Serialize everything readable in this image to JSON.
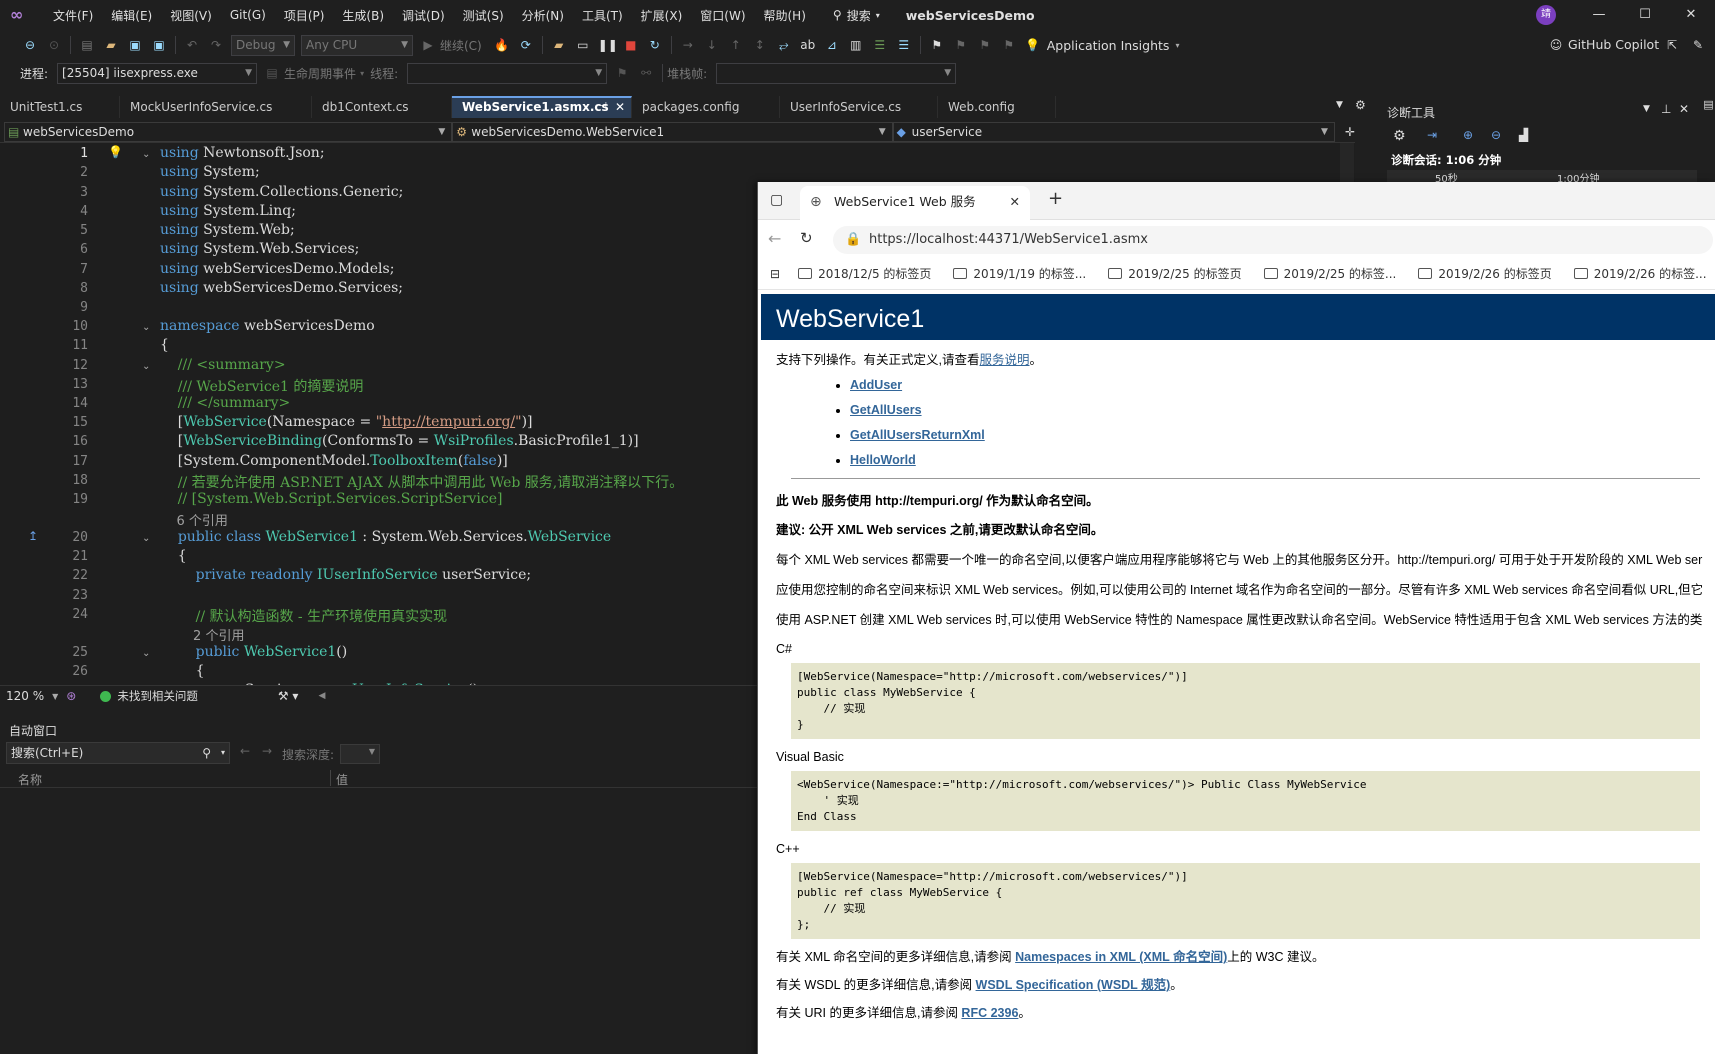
{
  "menubar": {
    "items": [
      "文件(F)",
      "编辑(E)",
      "视图(V)",
      "Git(G)",
      "项目(P)",
      "生成(B)",
      "调试(D)",
      "测试(S)",
      "分析(N)",
      "工具(T)",
      "扩展(X)",
      "窗口(W)",
      "帮助(H)"
    ],
    "search": "搜索",
    "title": "webServicesDemo",
    "avatar": "靖"
  },
  "toolbar": {
    "config": "Debug",
    "platform": "Any CPU",
    "continue": "继续(C)",
    "insights": "Application Insights",
    "copilot": "GitHub Copilot"
  },
  "toolbar2": {
    "process_label": "进程:",
    "process_value": "[25504] iisexpress.exe",
    "lifecycle": "生命周期事件",
    "thread_label": "线程:",
    "stack_label": "堆栈帧:"
  },
  "tabs": [
    "UnitTest1.cs",
    "MockUserInfoService.cs",
    "db1Context.cs",
    "WebService1.asmx.cs",
    "packages.config",
    "UserInfoService.cs",
    "Web.config"
  ],
  "nav": {
    "project": "webServicesDemo",
    "class": "webServicesDemo.WebService1",
    "member": "userService"
  },
  "diag": {
    "title": "诊断工具",
    "session": "诊断会话: 1:06 分钟",
    "t1": "50秒",
    "t2": "1:00分钟"
  },
  "status": {
    "zoom": "120 %",
    "issues": "未找到相关问题"
  },
  "autos": {
    "title": "自动窗口",
    "search": "搜索(Ctrl+E)",
    "depth": "搜索深度:",
    "col_name": "名称",
    "col_value": "值"
  },
  "browser": {
    "tab": "WebService1 Web 服务",
    "url": "https://localhost:44371/WebService1.asmx",
    "favorites": [
      "2018/12/5 的标签页",
      "2019/1/19 的标签...",
      "2019/2/25 的标签页",
      "2019/2/25 的标签...",
      "2019/2/26 的标签页",
      "2019/2/26 的标签..."
    ]
  },
  "webpage": {
    "header": "WebService1",
    "intro": "支持下列操作。有关正式定义,请查看",
    "intro_link": "服务说明",
    "ops": [
      "AddUser",
      "GetAllUsers",
      "GetAllUsersReturnXml",
      "HelloWorld"
    ],
    "ns_note": "此 Web 服务使用 http://tempuri.org/ 作为默认命名空间。",
    "advice": "建议: 公开 XML Web services 之前,请更改默认命名空间。",
    "p1": "每个 XML Web services 都需要一个唯一的命名空间,以便客户端应用程序能够将它与 Web 上的其他服务区分开。http://tempuri.org/ 可用于处于开发阶段的 XML Web ser",
    "p2": "应使用您控制的命名空间来标识 XML Web services。例如,可以使用公司的 Internet 域名作为命名空间的一部分。尽管有许多 XML Web services 命名空间看似 URL,但它",
    "p3": "使用 ASP.NET 创建 XML Web services 时,可以使用 WebService 特性的 Namespace 属性更改默认命名空间。WebService 特性适用于包含 XML Web services 方法的类",
    "cs_label": "C#",
    "cs_code": "[WebService(Namespace=\"http://microsoft.com/webservices/\")]\npublic class MyWebService {\n    // 实现\n}",
    "vb_label": "Visual Basic",
    "vb_code": "<WebService(Namespace:=\"http://microsoft.com/webservices/\")> Public Class MyWebService\n    ' 实现\nEnd Class",
    "cpp_label": "C++",
    "cpp_code": "[WebService(Namespace=\"http://microsoft.com/webservices/\")]\npublic ref class MyWebService {\n    // 实现\n};",
    "f1a": "有关 XML 命名空间的更多详细信息,请参阅 ",
    "f1link": "Namespaces in XML (XML 命名空间)",
    "f1b": "上的 W3C 建议。",
    "f2a": "有关 WSDL 的更多详细信息,请参阅 ",
    "f2link": "WSDL Specification (WSDL 规范)",
    "f2b": "。",
    "f3a": "有关 URI 的更多详细信息,请参阅 ",
    "f3link": "RFC 2396",
    "f3b": "。"
  }
}
